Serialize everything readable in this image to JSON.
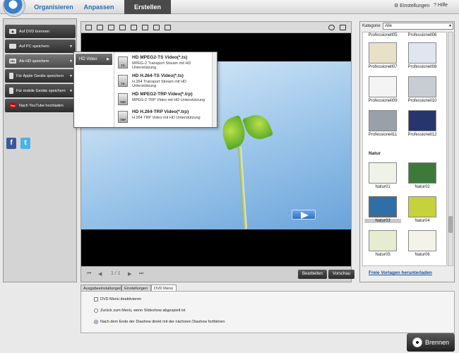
{
  "tabs": [
    {
      "label": "Organisieren"
    },
    {
      "label": "Anpassen"
    },
    {
      "label": "Erstellen"
    }
  ],
  "toplinks": {
    "settings": "Einstellungen",
    "help": "Hilfe"
  },
  "sidebar": {
    "items": [
      {
        "label": "Auf DVD brennen",
        "icon": "disc-icon"
      },
      {
        "label": "Auf PC speichern",
        "icon": "monitor-icon"
      },
      {
        "label": "Als HD speichern",
        "icon": "hd-icon"
      },
      {
        "label": "Für Apple Geräte speichern",
        "icon": "apple-device-icon"
      },
      {
        "label": "Für mobile Geräte speichern",
        "icon": "mobile-icon"
      },
      {
        "label": "Nach YouTube hochladen",
        "icon": "youtube-icon"
      }
    ],
    "hd_icon_text": "HD",
    "yt_icon_text": "You",
    "facebook": "f",
    "twitter": "t"
  },
  "popup": {
    "category": "HD Video",
    "items": [
      {
        "icon_text": "TS",
        "title": "HD MPEG2-TS Video(*.ts)",
        "desc": "MPEG-2 Transport Stream mit HD Unterstützung"
      },
      {
        "icon_text": "TS",
        "title": "HD H.264-TS Video(*.ts)",
        "desc": "H.264 Transport Stream mit HD Unterstützung"
      },
      {
        "icon_text": "TRP",
        "title": "HD MPEG2-TRP Video(*.trp)",
        "desc": "MPEG-2 TRP Video mit HD Unterstützung"
      },
      {
        "icon_text": "TRP",
        "title": "HD H.264-TRP Video(*.trp)",
        "desc": "H.264 TRP Video mit HD Unterstützung"
      }
    ]
  },
  "player": {
    "page": "1 / 1",
    "edit": "Bearbeiten",
    "preview": "Vorschau"
  },
  "right": {
    "category_label": "Kategorie",
    "category_value": "Alle",
    "pro": [
      "Professionell05",
      "Professionell06",
      "Professionell07",
      "Professionell08",
      "Professionell09",
      "Professionell10",
      "Professionell11",
      "Professionell12"
    ],
    "nature_header": "Natur",
    "nature": [
      "Natur01",
      "Natur02",
      "Natur03",
      "Natur04",
      "Natur05",
      "Natur06"
    ],
    "download_link": "Freie Vorlagen herunterladen"
  },
  "bottom": {
    "tabs": [
      "Ausgabeeinstallungen",
      "Einstellungen",
      "DVD Menü"
    ],
    "options": [
      "DVD Menü deaktivieren",
      "Zurück zum Menü, wenn Slideshow abgespielt ist",
      "Nach dem Ende der Diashow direkt mit der nächsten Diashow fortfahren"
    ]
  },
  "burn": "Brennen"
}
